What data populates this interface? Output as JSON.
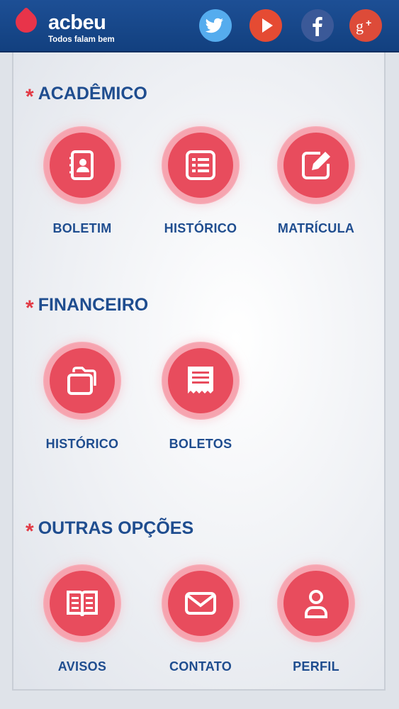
{
  "header": {
    "brand_name": "acbeu",
    "brand_slogan": "Todos falam bem",
    "social": [
      "twitter-icon",
      "youtube-icon",
      "facebook-icon",
      "google-plus-icon"
    ]
  },
  "sections": [
    {
      "title": "ACADÊMICO",
      "items": [
        {
          "label": "BOLETIM",
          "icon": "contacts-book-icon"
        },
        {
          "label": "HISTÓRICO",
          "icon": "list-icon"
        },
        {
          "label": "MATRÍCULA",
          "icon": "edit-icon"
        }
      ]
    },
    {
      "title": "FINANCEIRO",
      "items": [
        {
          "label": "HISTÓRICO",
          "icon": "folders-icon"
        },
        {
          "label": "BOLETOS",
          "icon": "receipt-icon"
        }
      ]
    },
    {
      "title": "OUTRAS OPÇÕES",
      "items": [
        {
          "label": "AVISOS",
          "icon": "open-book-icon"
        },
        {
          "label": "CONTATO",
          "icon": "envelope-icon"
        },
        {
          "label": "PERFIL",
          "icon": "user-icon"
        }
      ]
    }
  ],
  "colors": {
    "header_bg": "#1d4f95",
    "accent_red": "#e84c5d",
    "label_blue": "#1f4d8f"
  }
}
